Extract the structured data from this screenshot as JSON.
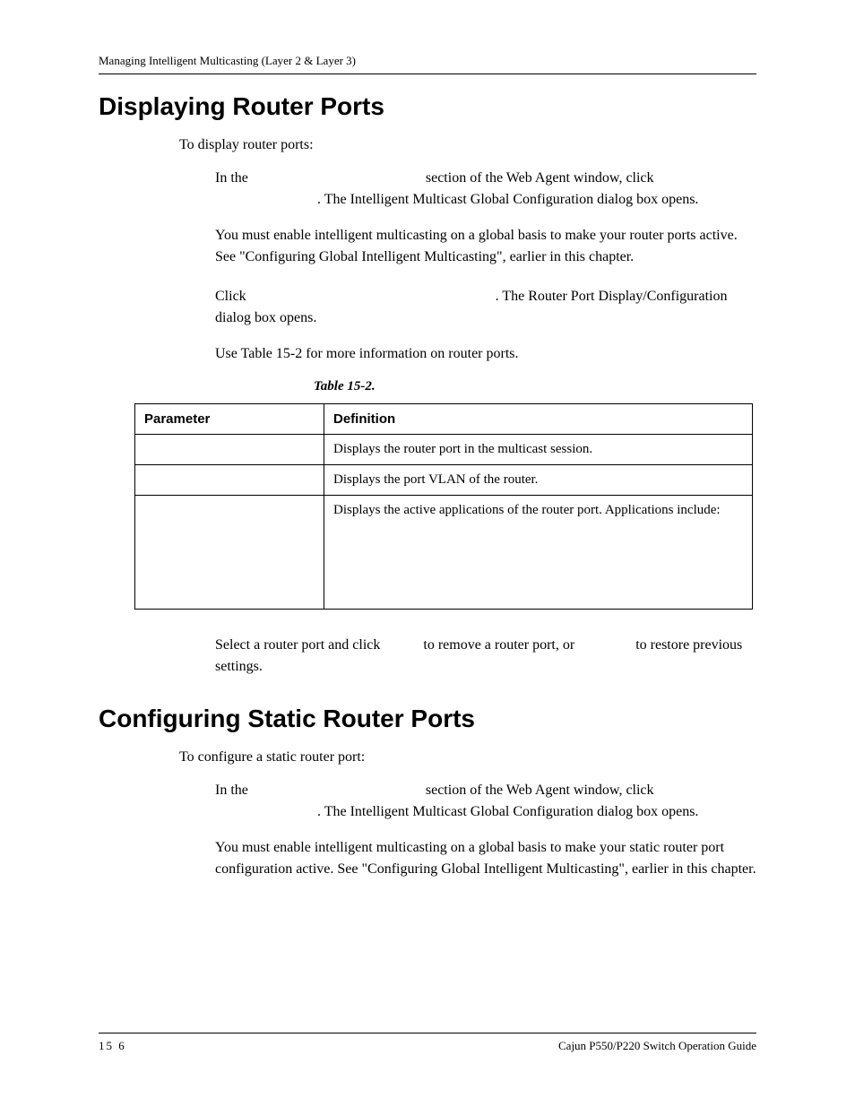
{
  "running_head": "Managing Intelligent Multicasting (Layer 2 & Layer 3)",
  "section1": {
    "title": "Displaying Router Ports",
    "intro": "To display router ports:",
    "step1a": "In the ",
    "step1b": " section of the Web Agent window, click ",
    "step1c": ". The Intelligent Multicast Global Configuration dialog box opens.",
    "note": " You must enable intelligent multicasting on a global basis to make your router ports active. See \"Configuring Global Intelligent Multicasting\", earlier in this chapter.",
    "step2a": "Click ",
    "step2b": ". The Router Port Display/Configuration dialog box opens.",
    "step3": "Use Table 15-2 for more information on router ports.",
    "step4a": "Select a router port and click ",
    "step4b": " to remove a router port, or ",
    "step4c": " to restore previous settings."
  },
  "table": {
    "caption": "Table 15-2.",
    "headers": [
      "Parameter",
      "Definition"
    ],
    "rows": [
      [
        "",
        "Displays the router port in the multicast session."
      ],
      [
        "",
        "Displays the port VLAN of the router."
      ],
      [
        "",
        "Displays the active applications of the router port. Applications include:"
      ]
    ]
  },
  "section2": {
    "title": "Configuring Static Router Ports",
    "intro": "To configure a static router port:",
    "step1a": "In the ",
    "step1b": " section of the Web Agent window, click ",
    "step1c": ". The Intelligent Multicast Global Configuration dialog box opens.",
    "note": " You must enable intelligent multicasting on a global basis to make your static router port configuration active. See \"Configuring Global Intelligent Multicasting\", earlier in this chapter."
  },
  "footer": {
    "left": "15 6",
    "right": "Cajun P550/P220 Switch Operation Guide"
  }
}
